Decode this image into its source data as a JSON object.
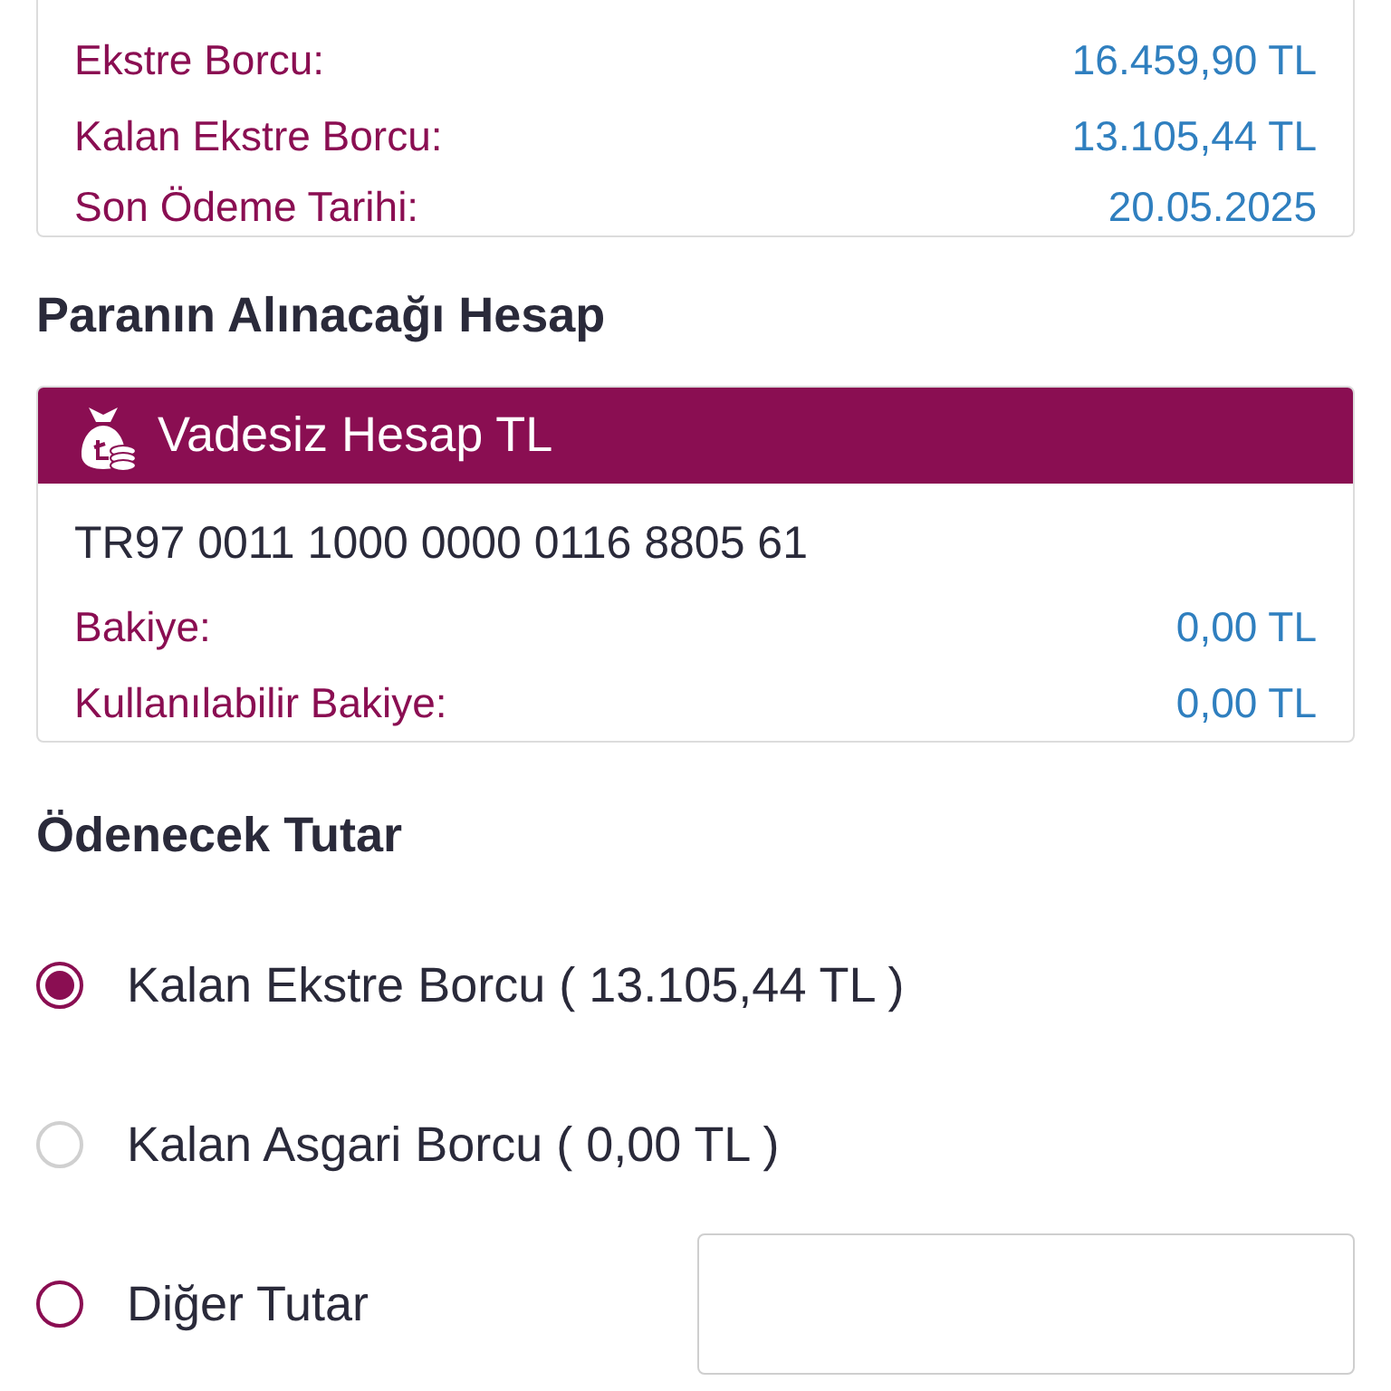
{
  "statement": {
    "rows": [
      {
        "label": "Ekstre Borcu:",
        "value": "16.459,90 TL"
      },
      {
        "label": "Kalan Ekstre Borcu:",
        "value": "13.105,44 TL"
      },
      {
        "label": "Son Ödeme Tarihi:",
        "value": "20.05.2025"
      }
    ]
  },
  "source_account": {
    "heading": "Paranın Alınacağı Hesap",
    "name": "Vadesiz Hesap TL",
    "iban": "TR97 0011 1000 0000 0116 8805 61",
    "rows": [
      {
        "label": "Bakiye:",
        "value": "0,00 TL"
      },
      {
        "label": "Kullanılabilir Bakiye:",
        "value": "0,00 TL"
      }
    ]
  },
  "amount": {
    "heading": "Ödenecek Tutar",
    "options": [
      {
        "kind": "fixed",
        "label": "Kalan Ekstre Borcu ( 13.105,44 TL )",
        "selected": true,
        "disabled": false
      },
      {
        "kind": "fixed",
        "label": "Kalan Asgari Borcu ( 0,00 TL )",
        "selected": false,
        "disabled": true
      },
      {
        "kind": "input",
        "label": "Diğer Tutar",
        "selected": false,
        "disabled": false
      }
    ]
  }
}
